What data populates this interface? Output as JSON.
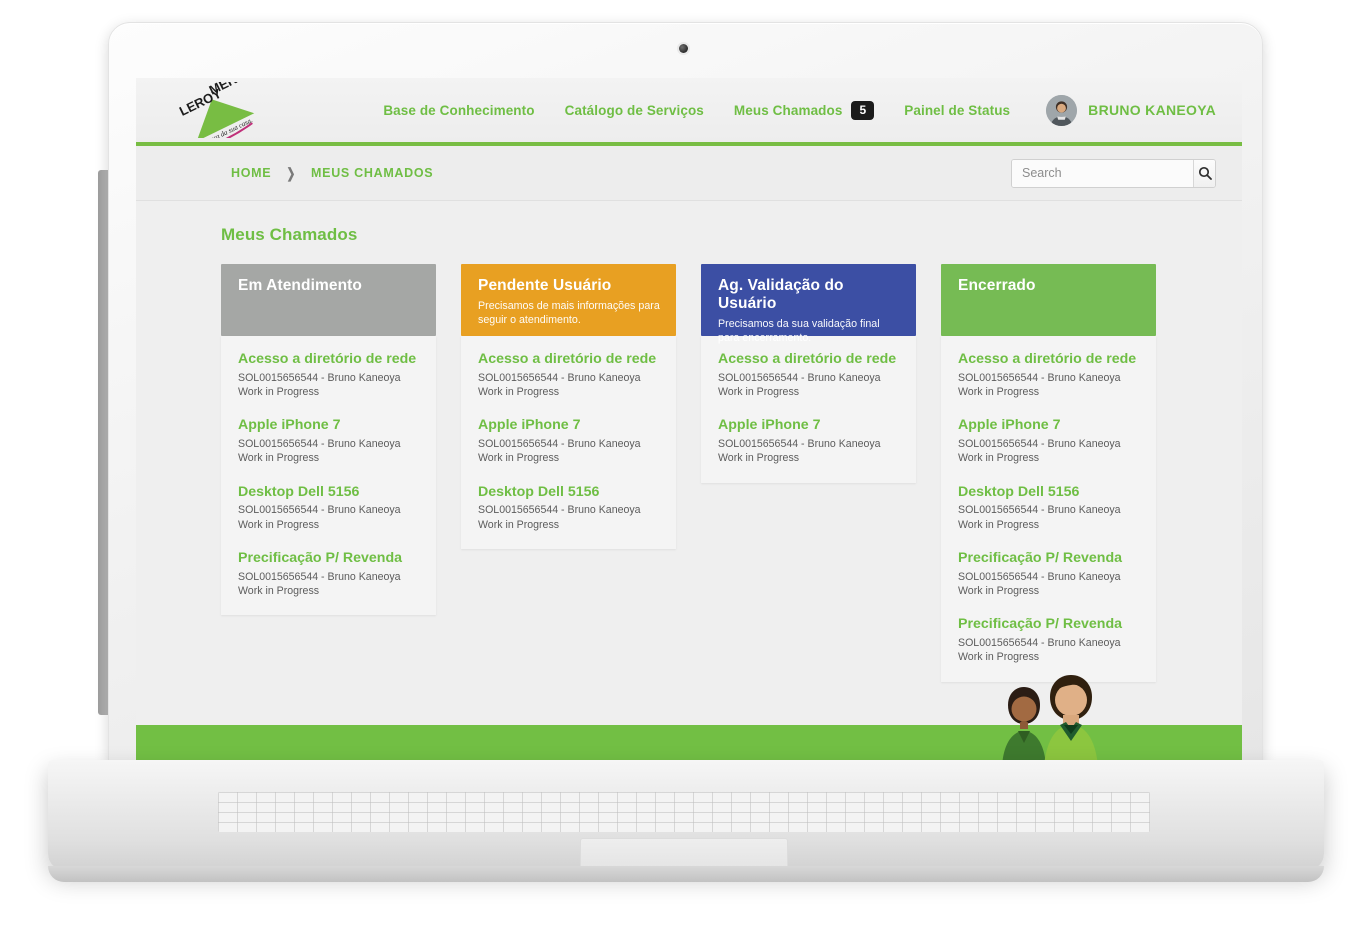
{
  "header": {
    "logo_alt": "LEROY MERLIN",
    "logo_line1": "LEROY",
    "logo_line2": "MERLIN",
    "logo_tagline": "A casa da sua casa.",
    "nav": [
      {
        "label": "Base de Conhecimento",
        "badge": null
      },
      {
        "label": "Catálogo de Serviços",
        "badge": null
      },
      {
        "label": "Meus Chamados",
        "badge": "5"
      },
      {
        "label": "Painel de Status",
        "badge": null
      }
    ],
    "user_name": "BRUNO KANEOYA"
  },
  "breadcrumb": {
    "items": [
      "HOME",
      "MEUS CHAMADOS"
    ],
    "separator": "❯"
  },
  "search": {
    "placeholder": "Search",
    "value": "",
    "icon": "search-icon"
  },
  "main": {
    "page_title": "Meus Chamados",
    "columns": [
      {
        "title": "Em Atendimento",
        "subtitle": "",
        "color": "#a5a7a5",
        "tickets": [
          {
            "title": "Acesso a diretório de rede",
            "meta_id": "SOL0015656544 - Bruno Kaneoya",
            "meta_status": "Work in Progress"
          },
          {
            "title": "Apple iPhone 7",
            "meta_id": "SOL0015656544 - Bruno Kaneoya",
            "meta_status": "Work in Progress"
          },
          {
            "title": "Desktop Dell 5156",
            "meta_id": "SOL0015656544 - Bruno Kaneoya",
            "meta_status": "Work in Progress"
          },
          {
            "title": "Precificação P/ Revenda",
            "meta_id": "SOL0015656544 - Bruno Kaneoya",
            "meta_status": "Work in Progress"
          }
        ]
      },
      {
        "title": "Pendente Usuário",
        "subtitle": "Precisamos de mais informações para seguir o atendimento.",
        "color": "#e8a022",
        "tickets": [
          {
            "title": "Acesso a diretório de rede",
            "meta_id": "SOL0015656544 - Bruno Kaneoya",
            "meta_status": "Work in Progress"
          },
          {
            "title": "Apple iPhone 7",
            "meta_id": "SOL0015656544 - Bruno Kaneoya",
            "meta_status": "Work in Progress"
          },
          {
            "title": "Desktop Dell 5156",
            "meta_id": "SOL0015656544 - Bruno Kaneoya",
            "meta_status": "Work in Progress"
          }
        ]
      },
      {
        "title": "Ag. Validação do Usuário",
        "subtitle": "Precisamos da sua validação final para encerramento.",
        "color": "#3c4fa4",
        "tickets": [
          {
            "title": "Acesso a diretório de rede",
            "meta_id": "SOL0015656544 - Bruno Kaneoya",
            "meta_status": "Work in Progress"
          },
          {
            "title": "Apple iPhone 7",
            "meta_id": "SOL0015656544 - Bruno Kaneoya",
            "meta_status": "Work in Progress"
          }
        ]
      },
      {
        "title": "Encerrado",
        "subtitle": "",
        "color": "#76bb54",
        "tickets": [
          {
            "title": "Acesso a diretório de rede",
            "meta_id": "SOL0015656544 - Bruno Kaneoya",
            "meta_status": "Work in Progress"
          },
          {
            "title": "Apple iPhone 7",
            "meta_id": "SOL0015656544 - Bruno Kaneoya",
            "meta_status": "Work in Progress"
          },
          {
            "title": "Desktop Dell 5156",
            "meta_id": "SOL0015656544 - Bruno Kaneoya",
            "meta_status": "Work in Progress"
          },
          {
            "title": "Precificação P/ Revenda",
            "meta_id": "SOL0015656544 - Bruno Kaneoya",
            "meta_status": "Work in Progress"
          },
          {
            "title": "Precificação P/ Revenda",
            "meta_id": "SOL0015656544 - Bruno Kaneoya",
            "meta_status": "Work in Progress"
          }
        ]
      }
    ]
  },
  "theme": {
    "brand_green": "#6fbe44",
    "footer_green": "#72bf44",
    "badge_dark": "#1b1b1b",
    "page_bg": "#efefef",
    "card_bg": "#f4f4f4"
  }
}
